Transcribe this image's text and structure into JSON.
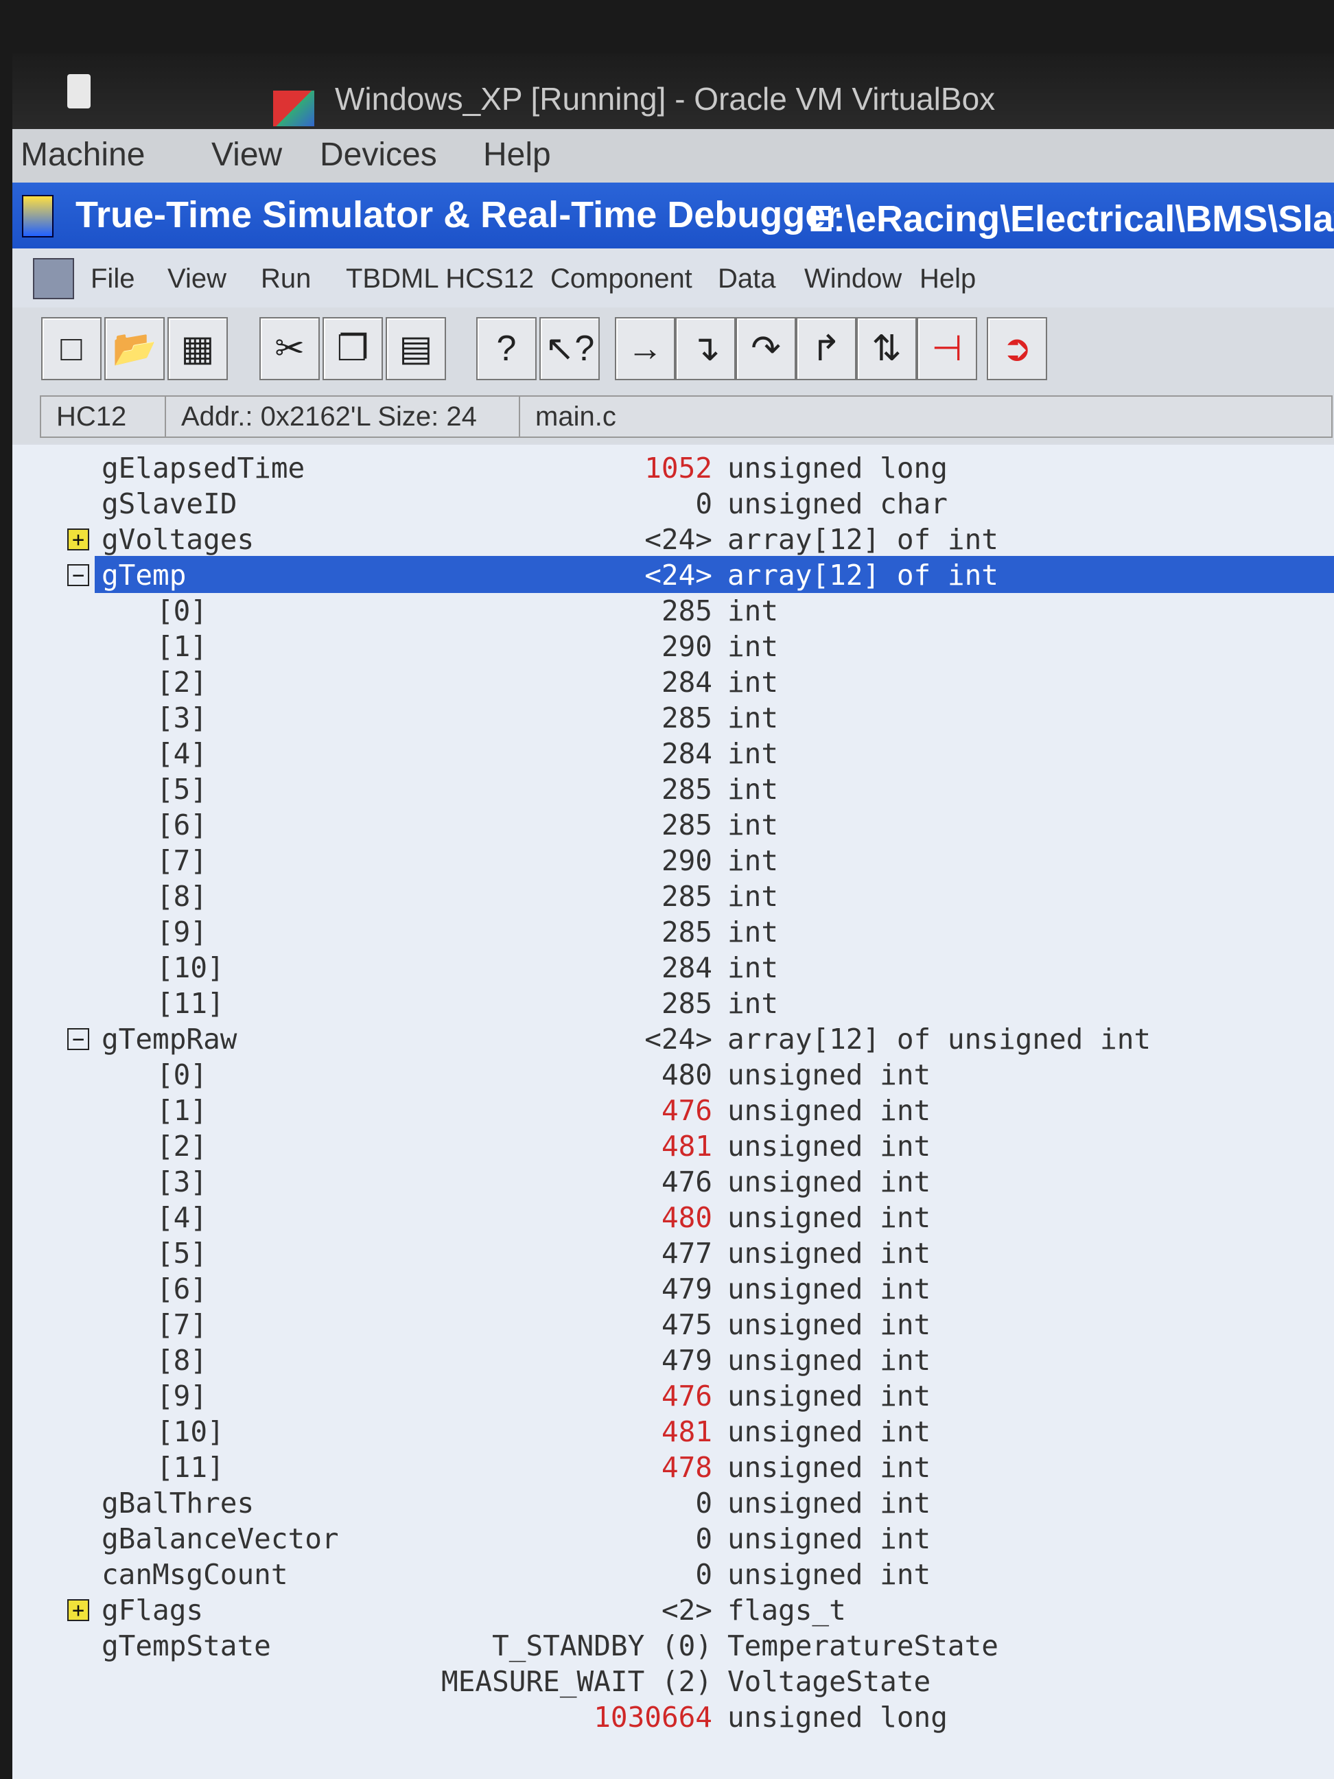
{
  "vbox": {
    "title": "Windows_XP [Running] - Oracle VM VirtualBox",
    "menu": [
      "Machine",
      "View",
      "Devices",
      "Help"
    ]
  },
  "app": {
    "title": "True-Time Simulator & Real-Time Debugger",
    "path": "E:\\eRacing\\Electrical\\BMS\\Slave\\Softw",
    "menu": [
      "File",
      "View",
      "Run",
      "TBDML HCS12",
      "Component",
      "Data",
      "Window",
      "Help"
    ]
  },
  "toolbar": {
    "buttons": [
      "new-icon",
      "open-icon",
      "save-icon",
      "cut-icon",
      "copy-icon",
      "paste-icon",
      "help-icon",
      "context-help-icon",
      "start-icon",
      "single-step-icon",
      "step-over-icon",
      "step-out-icon",
      "assembly-step-icon",
      "halt-icon",
      "reset-icon"
    ]
  },
  "status": {
    "cpu": "HC12",
    "addr": "Addr.: 0x2162'L Size: 24",
    "module": "main.c"
  },
  "rows": [
    {
      "name": "gElapsedTime",
      "value": "1052",
      "type": "unsigned long",
      "changed": true,
      "indent": 0,
      "expander": ""
    },
    {
      "name": "gSlaveID",
      "value": "0",
      "type": "unsigned char",
      "changed": false,
      "indent": 0,
      "expander": ""
    },
    {
      "name": "gVoltages",
      "value": "<24>",
      "type": "array[12] of int",
      "changed": false,
      "indent": 0,
      "expander": "+"
    },
    {
      "name": "gTemp",
      "value": "<24>",
      "type": "array[12] of int",
      "changed": false,
      "indent": 0,
      "expander": "-",
      "selected": true
    },
    {
      "name": "[0]",
      "value": "285",
      "type": "int",
      "changed": false,
      "indent": 1,
      "expander": ""
    },
    {
      "name": "[1]",
      "value": "290",
      "type": "int",
      "changed": false,
      "indent": 1,
      "expander": ""
    },
    {
      "name": "[2]",
      "value": "284",
      "type": "int",
      "changed": false,
      "indent": 1,
      "expander": ""
    },
    {
      "name": "[3]",
      "value": "285",
      "type": "int",
      "changed": false,
      "indent": 1,
      "expander": ""
    },
    {
      "name": "[4]",
      "value": "284",
      "type": "int",
      "changed": false,
      "indent": 1,
      "expander": ""
    },
    {
      "name": "[5]",
      "value": "285",
      "type": "int",
      "changed": false,
      "indent": 1,
      "expander": ""
    },
    {
      "name": "[6]",
      "value": "285",
      "type": "int",
      "changed": false,
      "indent": 1,
      "expander": ""
    },
    {
      "name": "[7]",
      "value": "290",
      "type": "int",
      "changed": false,
      "indent": 1,
      "expander": ""
    },
    {
      "name": "[8]",
      "value": "285",
      "type": "int",
      "changed": false,
      "indent": 1,
      "expander": ""
    },
    {
      "name": "[9]",
      "value": "285",
      "type": "int",
      "changed": false,
      "indent": 1,
      "expander": ""
    },
    {
      "name": "[10]",
      "value": "284",
      "type": "int",
      "changed": false,
      "indent": 1,
      "expander": ""
    },
    {
      "name": "[11]",
      "value": "285",
      "type": "int",
      "changed": false,
      "indent": 1,
      "expander": ""
    },
    {
      "name": "gTempRaw",
      "value": "<24>",
      "type": "array[12] of unsigned int",
      "changed": false,
      "indent": 0,
      "expander": "-"
    },
    {
      "name": "[0]",
      "value": "480",
      "type": "unsigned int",
      "changed": false,
      "indent": 1,
      "expander": ""
    },
    {
      "name": "[1]",
      "value": "476",
      "type": "unsigned int",
      "changed": true,
      "indent": 1,
      "expander": ""
    },
    {
      "name": "[2]",
      "value": "481",
      "type": "unsigned int",
      "changed": true,
      "indent": 1,
      "expander": ""
    },
    {
      "name": "[3]",
      "value": "476",
      "type": "unsigned int",
      "changed": false,
      "indent": 1,
      "expander": ""
    },
    {
      "name": "[4]",
      "value": "480",
      "type": "unsigned int",
      "changed": true,
      "indent": 1,
      "expander": ""
    },
    {
      "name": "[5]",
      "value": "477",
      "type": "unsigned int",
      "changed": false,
      "indent": 1,
      "expander": ""
    },
    {
      "name": "[6]",
      "value": "479",
      "type": "unsigned int",
      "changed": false,
      "indent": 1,
      "expander": ""
    },
    {
      "name": "[7]",
      "value": "475",
      "type": "unsigned int",
      "changed": false,
      "indent": 1,
      "expander": ""
    },
    {
      "name": "[8]",
      "value": "479",
      "type": "unsigned int",
      "changed": false,
      "indent": 1,
      "expander": ""
    },
    {
      "name": "[9]",
      "value": "476",
      "type": "unsigned int",
      "changed": true,
      "indent": 1,
      "expander": ""
    },
    {
      "name": "[10]",
      "value": "481",
      "type": "unsigned int",
      "changed": true,
      "indent": 1,
      "expander": ""
    },
    {
      "name": "[11]",
      "value": "478",
      "type": "unsigned int",
      "changed": true,
      "indent": 1,
      "expander": ""
    },
    {
      "name": "gBalThres",
      "value": "0",
      "type": "unsigned int",
      "changed": false,
      "indent": 0,
      "expander": ""
    },
    {
      "name": "gBalanceVector",
      "value": "0",
      "type": "unsigned int",
      "changed": false,
      "indent": 0,
      "expander": ""
    },
    {
      "name": "canMsgCount",
      "value": "0",
      "type": "unsigned int",
      "changed": false,
      "indent": 0,
      "expander": ""
    },
    {
      "name": "gFlags",
      "value": "<2>",
      "type": "flags_t",
      "changed": false,
      "indent": 0,
      "expander": "+"
    },
    {
      "name": "gTempState",
      "value": "T_STANDBY (0)",
      "type": "TemperatureState",
      "changed": false,
      "indent": 0,
      "expander": ""
    },
    {
      "name": "",
      "value": "MEASURE_WAIT (2)",
      "type": "VoltageState",
      "changed": false,
      "indent": 0,
      "expander": ""
    },
    {
      "name": "",
      "value": "1030664",
      "type": "unsigned long",
      "changed": true,
      "indent": 0,
      "expander": ""
    }
  ]
}
